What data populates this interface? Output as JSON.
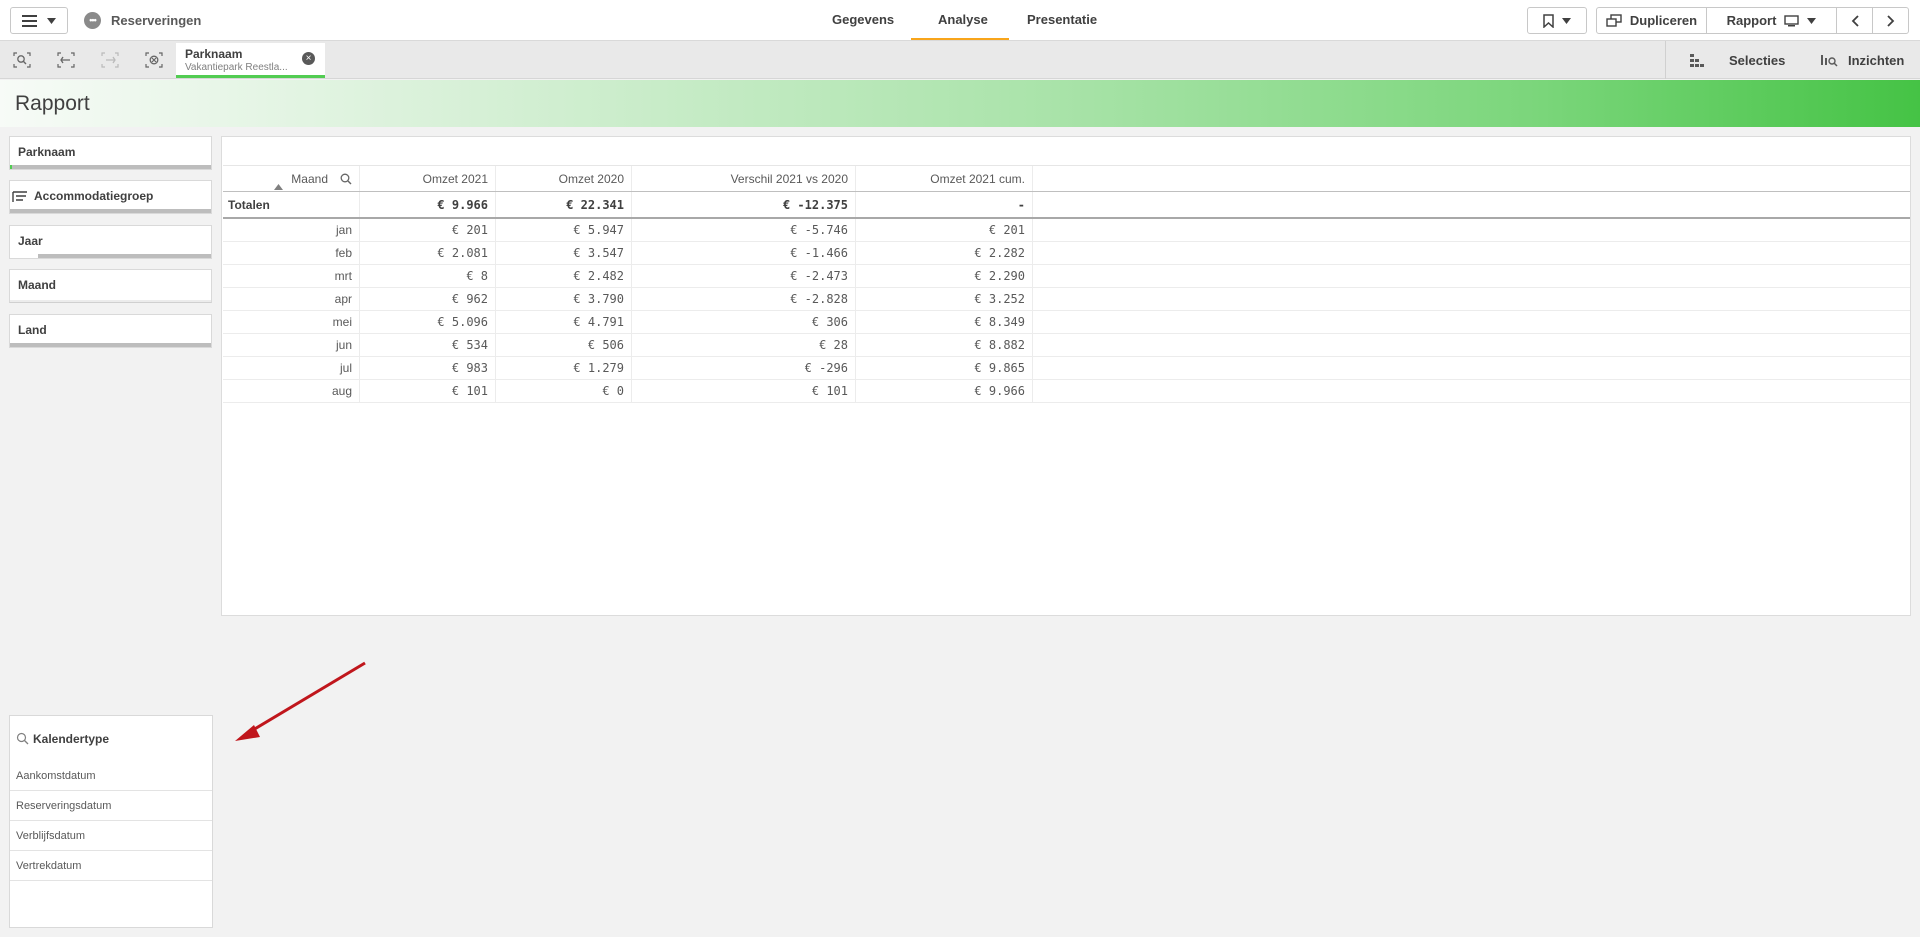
{
  "app": {
    "title": "Reserveringen"
  },
  "nav": {
    "tabs": [
      "Gegevens",
      "Analyse",
      "Presentatie"
    ],
    "active": "Analyse"
  },
  "toolbar": {
    "duplicate_label": "Dupliceren",
    "sheet_label": "Rapport"
  },
  "selection_bar": {
    "chip": {
      "field": "Parknaam",
      "value": "Vakantiepark Reestla..."
    },
    "selections_label": "Selecties",
    "insights_label": "Inzichten"
  },
  "sheet": {
    "title": "Rapport"
  },
  "filters": [
    {
      "label": "Parknaam",
      "selected_fraction": 0.01
    },
    {
      "label": "Accommodatiegroep",
      "selected_fraction": 0
    },
    {
      "label": "Jaar",
      "selected_fraction": 0.14
    },
    {
      "label": "Maand",
      "selected_fraction": 0
    },
    {
      "label": "Land",
      "selected_fraction": 0
    }
  ],
  "table": {
    "columns": [
      "Maand",
      "Omzet 2021",
      "Omzet 2020",
      "Verschil 2021 vs 2020",
      "Omzet 2021 cum."
    ],
    "totals": [
      "Totalen",
      "€ 9.966",
      "€ 22.341",
      "€ -12.375",
      "-"
    ],
    "rows": [
      [
        "jan",
        "€ 201",
        "€ 5.947",
        "€ -5.746",
        "€ 201"
      ],
      [
        "feb",
        "€ 2.081",
        "€ 3.547",
        "€ -1.466",
        "€ 2.282"
      ],
      [
        "mrt",
        "€ 8",
        "€ 2.482",
        "€ -2.473",
        "€ 2.290"
      ],
      [
        "apr",
        "€ 962",
        "€ 3.790",
        "€ -2.828",
        "€ 3.252"
      ],
      [
        "mei",
        "€ 5.096",
        "€ 4.791",
        "€ 306",
        "€ 8.349"
      ],
      [
        "jun",
        "€ 534",
        "€ 506",
        "€ 28",
        "€ 8.882"
      ],
      [
        "jul",
        "€ 983",
        "€ 1.279",
        "€ -296",
        "€ 9.865"
      ],
      [
        "aug",
        "€ 101",
        "€ 0",
        "€ 101",
        "€ 9.966"
      ]
    ]
  },
  "kalendertype": {
    "title": "Kalendertype",
    "items": [
      "Aankomstdatum",
      "Reserveringsdatum",
      "Verblijfsdatum",
      "Vertrekdatum"
    ]
  },
  "colors": {
    "accent": "#52cc52",
    "tab_underline": "#f8a51b",
    "arrow": "#c0161c"
  }
}
